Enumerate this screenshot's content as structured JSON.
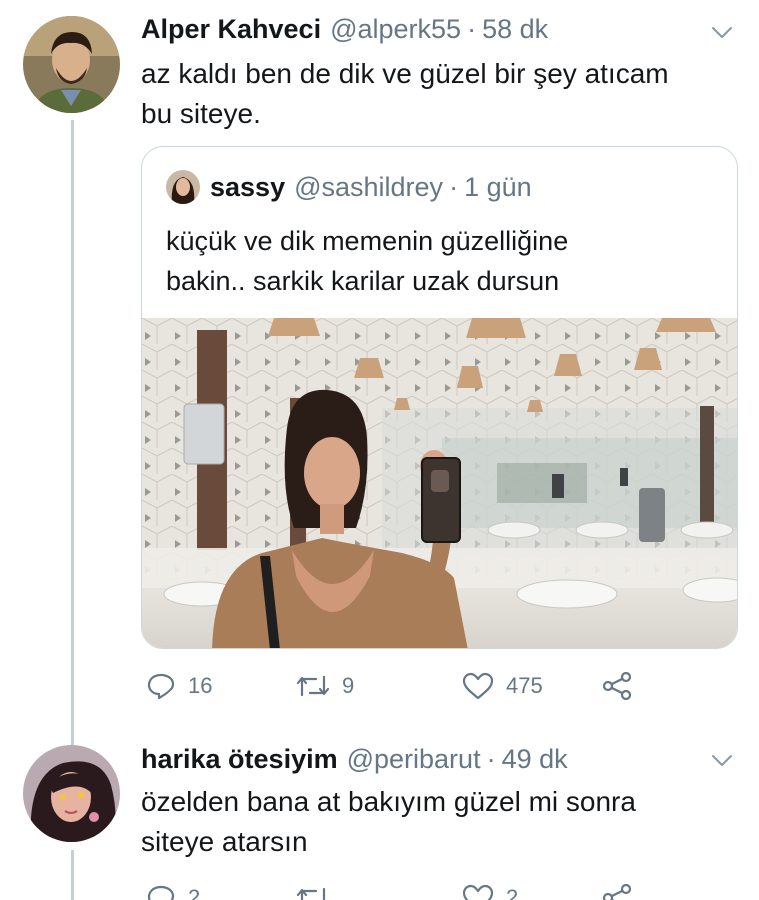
{
  "tweet1": {
    "name": "Alper Kahveci",
    "handle": "@alperk55",
    "separator": "·",
    "time": "58 dk",
    "text_line1": "az kaldı ben de dik ve güzel bir şey atıcam",
    "text_line2": "bu siteye.",
    "quote": {
      "name": "sassy",
      "handle": "@sashildrey",
      "separator": "·",
      "time": "1 gün",
      "text_line1": "küçük ve dik memenin güzelliğine",
      "text_line2": "bakin.. sarkik karilar uzak dursun"
    },
    "actions": {
      "reply_count": "16",
      "retweet_count": "9",
      "like_count": "475"
    }
  },
  "tweet2": {
    "name": "harika ötesiyim",
    "handle": "@peribarut",
    "separator": "·",
    "time": "49 dk",
    "text_line1": "özelden bana at bakıyım güzel mi sonra",
    "text_line2": "siteye atarsın",
    "actions": {
      "reply_count": "2",
      "retweet_count": "",
      "like_count": "2"
    }
  },
  "icons": [
    "reply-icon",
    "retweet-icon",
    "like-icon",
    "share-icon",
    "chevron-down-icon"
  ],
  "colors": {
    "secondary_text": "#657786",
    "border": "#ccd6dd",
    "thread_line": "#c4cfd6"
  }
}
